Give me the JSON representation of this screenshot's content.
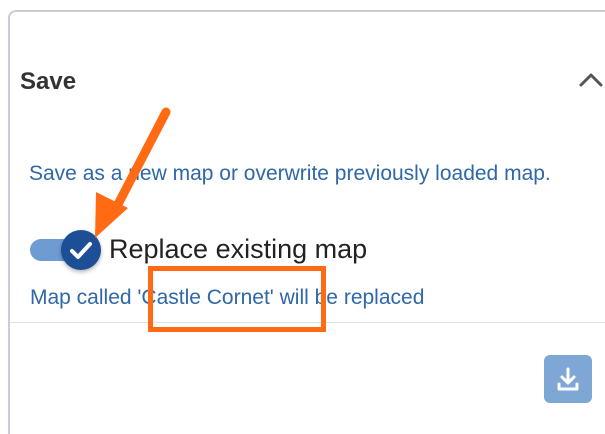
{
  "panel": {
    "title": "Save",
    "description": "Save as a new map or overwrite previously loaded map.",
    "toggle": {
      "label": "Replace existing map",
      "checked": true
    },
    "replace_note": "Map called 'Castle Cornet' will be replaced"
  },
  "icons": {
    "collapse": "chevron-up-icon",
    "toggle_check": "check-icon",
    "download": "download-icon"
  },
  "colors": {
    "link_text": "#2f67a8",
    "toggle_knob": "#1d4f96",
    "toggle_track": "#6f9bd3",
    "download_button": "#7ea7d6",
    "annotation": "#ff6a13"
  }
}
